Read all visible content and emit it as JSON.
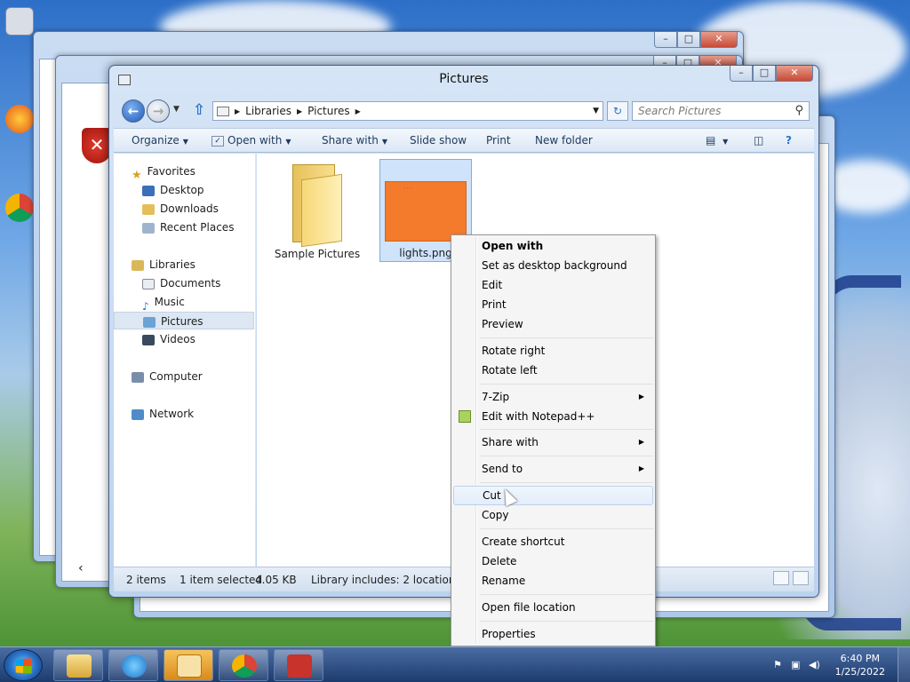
{
  "window": {
    "title": "Pictures"
  },
  "address": {
    "crumbs": [
      "Libraries",
      "Pictures"
    ]
  },
  "search": {
    "placeholder": "Search Pictures"
  },
  "toolbar": {
    "organize": "Organize",
    "open_with": "Open with",
    "share_with": "Share with",
    "slide_show": "Slide show",
    "print": "Print",
    "new_folder": "New folder"
  },
  "nav": {
    "favorites": "Favorites",
    "desktop": "Desktop",
    "downloads": "Downloads",
    "recent_places": "Recent Places",
    "libraries": "Libraries",
    "documents": "Documents",
    "music": "Music",
    "pictures": "Pictures",
    "videos": "Videos",
    "computer": "Computer",
    "network": "Network"
  },
  "files": [
    {
      "name": "Sample Pictures",
      "type": "folder"
    },
    {
      "name": "lights.png",
      "type": "image",
      "selected": true
    }
  ],
  "status": {
    "items": "2 items",
    "selected": "1 item selected",
    "size": "4.05 KB",
    "library": "Library includes: 2 locations"
  },
  "context_menu": {
    "open_with": "Open with",
    "set_bg": "Set as desktop background",
    "edit": "Edit",
    "print": "Print",
    "preview": "Preview",
    "rotate_right": "Rotate right",
    "rotate_left": "Rotate left",
    "zip": "7-Zip",
    "notepadpp": "Edit with Notepad++",
    "share_with": "Share with",
    "send_to": "Send to",
    "cut": "Cut",
    "copy": "Copy",
    "create_shortcut": "Create shortcut",
    "delete": "Delete",
    "rename": "Rename",
    "open_location": "Open file location",
    "properties": "Properties"
  },
  "taskbar": {
    "time": "6:40 PM",
    "date": "1/25/2022"
  },
  "colors": {
    "accent": "#2a72c8",
    "thumbnail": "#f47a2c",
    "taskbar": "#1d3b6d"
  }
}
